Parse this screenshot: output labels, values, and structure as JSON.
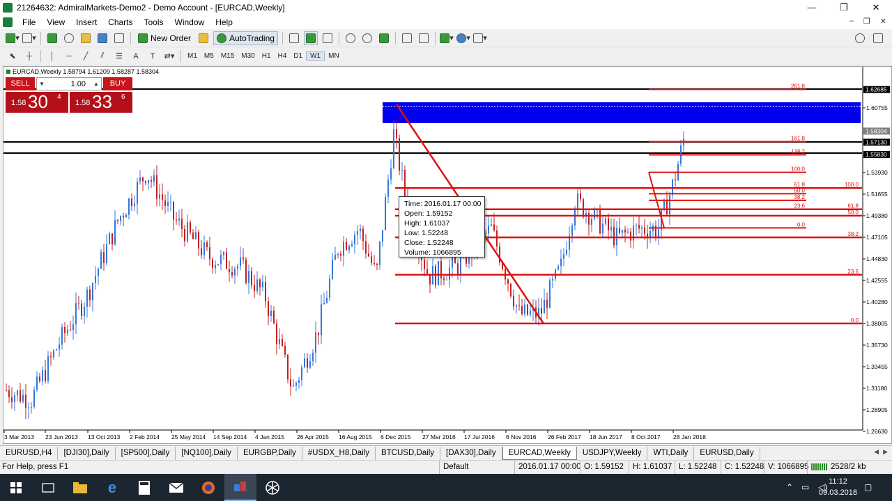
{
  "window": {
    "title": "21264632: AdmiralMarkets-Demo2 - Demo Account - [EURCAD,Weekly]",
    "minimize": "—",
    "maximize": "❐",
    "close": "✕"
  },
  "menu": {
    "items": [
      "File",
      "View",
      "Insert",
      "Charts",
      "Tools",
      "Window",
      "Help"
    ],
    "mdi_minimize": "–",
    "mdi_restore": "❐",
    "mdi_close": "✕"
  },
  "toolbar": {
    "new_order": "New Order",
    "autotrading": "AutoTrading"
  },
  "timeframes": [
    "M1",
    "M5",
    "M15",
    "M30",
    "H1",
    "H4",
    "D1",
    "W1",
    "MN"
  ],
  "active_timeframe": "W1",
  "chart": {
    "symbol_line": "EURCAD,Weekly  1.58794 1.61209 1.58287 1.58304",
    "one_click": {
      "sell_label": "SELL",
      "buy_label": "BUY",
      "lot": "1.00",
      "sell_small": "1.58",
      "sell_big": "30",
      "sell_sup": "4",
      "buy_small": "1.58",
      "buy_big": "33",
      "buy_sup": "6"
    },
    "price_labels": [
      "1.60755",
      "1.53930",
      "1.51655",
      "1.49380",
      "1.47105",
      "1.44830",
      "1.42555",
      "1.40280",
      "1.38005",
      "1.35730",
      "1.33455",
      "1.31180",
      "1.28905",
      "1.26630"
    ],
    "highlight_labels": [
      {
        "text": "1.62685",
        "y": 1.62685
      },
      {
        "text": "1.58304",
        "y": 1.58304,
        "grey": true
      },
      {
        "text": "1.57130",
        "y": 1.5713
      },
      {
        "text": "1.55830",
        "y": 1.5583
      }
    ],
    "date_labels": [
      "3 Mar 2013",
      "23 Jun 2013",
      "13 Oct 2013",
      "2 Feb 2014",
      "25 May 2014",
      "14 Sep 2014",
      "4 Jan 2015",
      "26 Apr 2015",
      "16 Aug 2015",
      "6 Dec 2015",
      "27 Mar 2016",
      "17 Jul 2016",
      "6 Nov 2016",
      "26 Feb 2017",
      "18 Jun 2017",
      "8 Oct 2017",
      "28 Jan 2018"
    ],
    "fib_big": [
      "100.0",
      "61.8",
      "50.0",
      "38.2",
      "23.6",
      "0.0"
    ],
    "fib_small": [
      "261.8",
      "161.8",
      "138.2",
      "100.0",
      "61.8",
      "50.0",
      "38.2",
      "23.6",
      "0.0"
    ],
    "colors": {
      "bull": "#3377dd",
      "bear": "#c81e1e",
      "fib": "#e01010",
      "zone": "#0000ee"
    }
  },
  "tooltip": {
    "time": "Time: 2016.01.17 00:00",
    "open": "Open: 1.59152",
    "high": "High: 1.61037",
    "low": "Low:  1.52248",
    "close": "Close: 1.52248",
    "volume": "Volume: 1066895"
  },
  "tabs": [
    "EURUSD,H4",
    "[DJI30],Daily",
    "[SP500],Daily",
    "[NQ100],Daily",
    "EURGBP,Daily",
    "#USDX_H8,Daily",
    "BTCUSD,Daily",
    "[DAX30],Daily",
    "EURCAD,Weekly",
    "USDJPY,Weekly",
    "WTI,Daily",
    "EURUSD,Daily"
  ],
  "active_tab": "EURCAD,Weekly",
  "status": {
    "help": "For Help, press F1",
    "profile": "Default",
    "datetime": "2016.01.17 00:00",
    "open": "O: 1.59152",
    "high": "H: 1.61037",
    "low": "L: 1.52248",
    "close": "C: 1.52248",
    "volume": "V: 1066895",
    "traffic": "2528/2 kb"
  },
  "taskbar": {
    "time": "11:12",
    "date": "09.03.2018"
  }
}
